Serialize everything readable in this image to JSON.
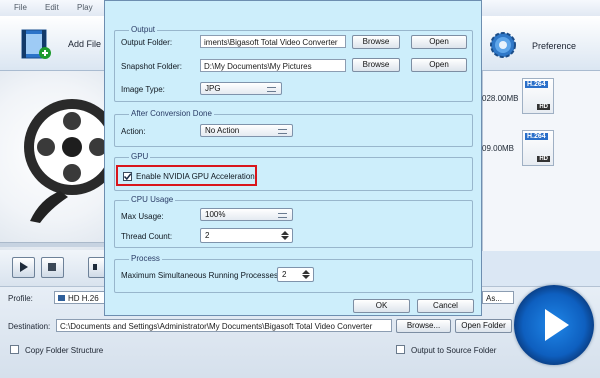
{
  "app": {
    "menu": [
      "File",
      "Edit",
      "Play"
    ],
    "toolbar": {
      "add_file": "Add File",
      "preference": "Preference"
    },
    "files": [
      {
        "size": "028.00MB",
        "codec": "H.264",
        "badge": "HD"
      },
      {
        "size": "09.00MB",
        "codec": "H.264",
        "badge": "HD"
      }
    ],
    "bottom": {
      "profile_label": "Profile:",
      "profile_value": "HD H.26",
      "profile_suffix": "As...",
      "destination_label": "Destination:",
      "destination_value": "C:\\Documents and Settings\\Administrator\\My Documents\\Bigasoft Total Video Converter",
      "browse_label": "Browse...",
      "open_folder_label": "Open Folder",
      "copy_folder_label": "Copy Folder Structure",
      "output_to_source_label": "Output to Source Folder"
    }
  },
  "dialog": {
    "output": {
      "title": "Output",
      "output_folder_label": "Output Folder:",
      "output_folder_value": "iments\\Bigasoft Total Video Converter",
      "snapshot_folder_label": "Snapshot Folder:",
      "snapshot_folder_value": "D:\\My Documents\\My Pictures",
      "browse_label": "Browse",
      "open_label": "Open",
      "image_type_label": "Image Type:",
      "image_type_value": "JPG"
    },
    "after_conversion": {
      "title": "After Conversion Done",
      "action_label": "Action:",
      "action_value": "No Action"
    },
    "gpu": {
      "title": "GPU",
      "enable_label": "Enable NVIDIA GPU Acceleration",
      "enabled": true
    },
    "cpu": {
      "title": "CPU Usage",
      "max_usage_label": "Max Usage:",
      "max_usage_value": "100%",
      "thread_count_label": "Thread Count:",
      "thread_count_value": "2"
    },
    "process": {
      "title": "Process",
      "max_processes_label": "Maximum Simultaneous Running Processes:",
      "max_processes_value": "2"
    },
    "ok_label": "OK",
    "cancel_label": "Cancel"
  },
  "colors": {
    "highlight": "#d9151b",
    "dialog_bg": "#cdeefb",
    "accent": "#0e5fbf"
  }
}
